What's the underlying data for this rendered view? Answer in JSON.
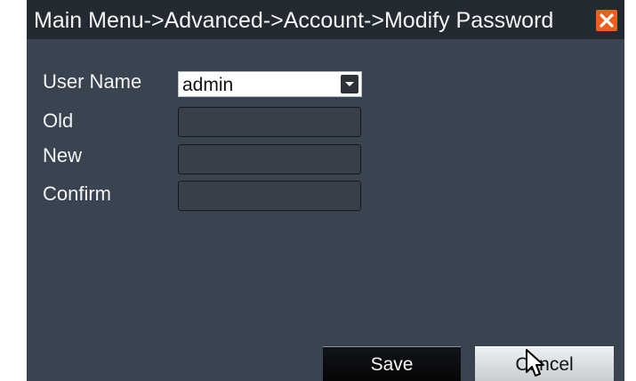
{
  "window": {
    "title": "Main Menu->Advanced->Account->Modify Password",
    "close_icon": "close-icon",
    "close_color": "#ee5e1c"
  },
  "form": {
    "user_name_label": "User Name",
    "user_name_value": "admin",
    "old_label": "Old",
    "new_label": "New",
    "confirm_label": "Confirm",
    "old_value": "",
    "new_value": "",
    "confirm_value": ""
  },
  "buttons": {
    "save_label": "Save",
    "cancel_label": "Cancel"
  },
  "icons": {
    "dropdown": "chevron-down-icon",
    "cursor": "mouse-cursor-icon"
  },
  "colors": {
    "panel": "#3a4450",
    "titlebar": "#242a31",
    "button_dark": "#050607",
    "button_light": "#dce0e4"
  }
}
